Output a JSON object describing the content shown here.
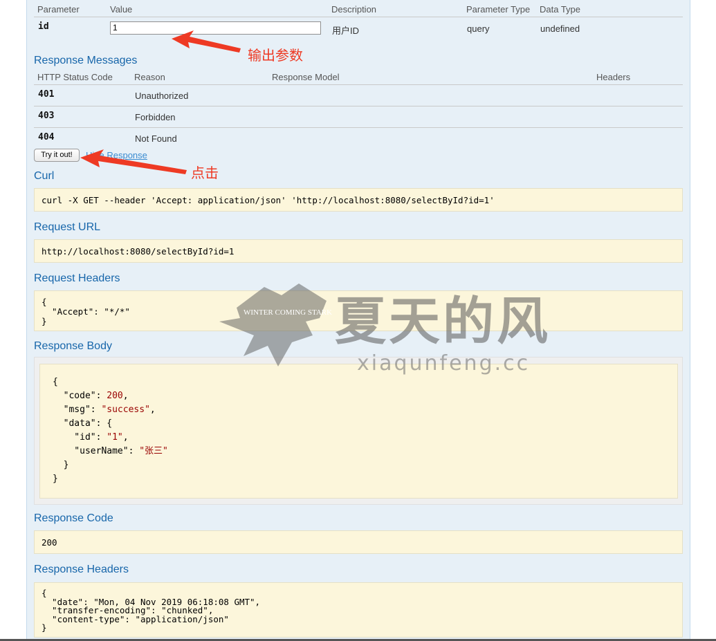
{
  "params": {
    "headers": [
      "Parameter",
      "Value",
      "Description",
      "Parameter Type",
      "Data Type"
    ],
    "row": {
      "name": "id",
      "value": "1",
      "description": "用户ID",
      "param_type": "query",
      "data_type": "undefined"
    }
  },
  "response_messages": {
    "title": "Response Messages",
    "headers": [
      "HTTP Status Code",
      "Reason",
      "Response Model",
      "Headers"
    ],
    "rows": [
      {
        "code": "401",
        "reason": "Unauthorized"
      },
      {
        "code": "403",
        "reason": "Forbidden"
      },
      {
        "code": "404",
        "reason": "Not Found"
      }
    ]
  },
  "actions": {
    "try_label": "Try it out!",
    "hide_label": "Hide Response"
  },
  "annotations": {
    "output_params": "输出参数",
    "click": "点击"
  },
  "curl": {
    "title": "Curl",
    "command": "curl -X GET --header 'Accept: application/json' 'http://localhost:8080/selectById?id=1'"
  },
  "request_url": {
    "title": "Request URL",
    "value": "http://localhost:8080/selectById?id=1"
  },
  "request_headers": {
    "title": "Request Headers",
    "value": "{\n  \"Accept\": \"*/*\"\n}"
  },
  "response_body": {
    "title": "Response Body",
    "lines": {
      "open": "{",
      "code_key": "  \"code\": ",
      "code_val": "200",
      "msg_key": "  \"msg\": ",
      "msg_val": "\"success\"",
      "data_key": "  \"data\": {",
      "id_key": "    \"id\": ",
      "id_val": "\"1\"",
      "user_key": "    \"userName\": ",
      "user_val": "\"张三\"",
      "inner_close": "  }",
      "close": "}"
    }
  },
  "response_code": {
    "title": "Response Code",
    "value": "200"
  },
  "response_headers": {
    "title": "Response Headers",
    "value": "{\n  \"date\": \"Mon, 04 Nov 2019 06:18:08 GMT\",\n  \"transfer-encoding\": \"chunked\",\n  \"content-type\": \"application/json\"\n}"
  },
  "watermark": {
    "title": "夏天的风",
    "site": "xiaqunfeng.cc",
    "logo_text": "WINTER COMING STARK"
  },
  "colors": {
    "section_title": "#1766aa",
    "code_bg": "#fcf6db",
    "panel_bg": "#e7f0f7",
    "annotation": "#ee3a24",
    "link": "#3a8bd0"
  }
}
